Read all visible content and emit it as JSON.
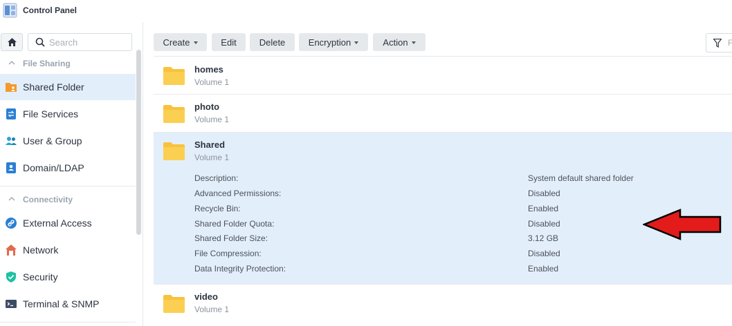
{
  "app": {
    "title": "Control Panel"
  },
  "search": {
    "placeholder": "Search"
  },
  "sidebar": {
    "sections": [
      {
        "label": "File Sharing",
        "items": [
          "Shared Folder",
          "File Services",
          "User & Group",
          "Domain/LDAP"
        ]
      },
      {
        "label": "Connectivity",
        "items": [
          "External Access",
          "Network",
          "Security",
          "Terminal & SNMP"
        ]
      }
    ],
    "active_item": "Shared Folder"
  },
  "toolbar": {
    "create": "Create",
    "edit": "Edit",
    "delete": "Delete",
    "encryption": "Encryption",
    "action": "Action",
    "filter_char": "F"
  },
  "folders": [
    {
      "name": "homes",
      "volume": "Volume 1"
    },
    {
      "name": "photo",
      "volume": "Volume 1"
    },
    {
      "name": "Shared",
      "volume": "Volume 1"
    },
    {
      "name": "video",
      "volume": "Volume 1"
    }
  ],
  "details": [
    {
      "label": "Description:",
      "value": "System default shared folder"
    },
    {
      "label": "Advanced Permissions:",
      "value": "Disabled"
    },
    {
      "label": "Recycle Bin:",
      "value": "Enabled"
    },
    {
      "label": "Shared Folder Quota:",
      "value": "Disabled"
    },
    {
      "label": "Shared Folder Size:",
      "value": "3.12 GB"
    },
    {
      "label": "File Compression:",
      "value": "Disabled"
    },
    {
      "label": "Data Integrity Protection:",
      "value": "Enabled"
    }
  ],
  "colors": {
    "accent": "#e3eefb",
    "folder": "#f9c23c",
    "arrow": "#e31b1b"
  }
}
